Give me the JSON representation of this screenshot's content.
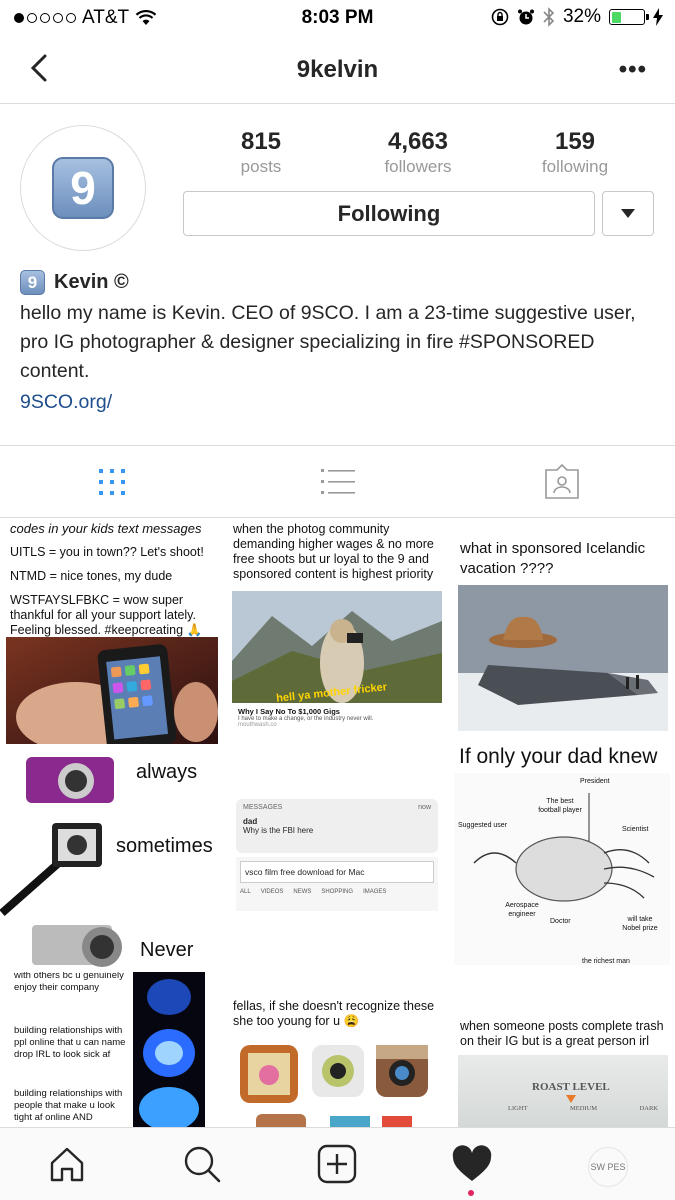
{
  "status_bar": {
    "carrier": "AT&T",
    "time": "8:03 PM",
    "battery_percent": "32%",
    "battery_level": 0.32,
    "signal_bars": 1,
    "icons": [
      "wifi-icon",
      "orientation-lock-icon",
      "alarm-icon",
      "bluetooth-icon",
      "battery-icon",
      "charging-icon"
    ]
  },
  "nav": {
    "title": "9kelvin",
    "more_label": "•••"
  },
  "profile": {
    "avatar_glyph": "9",
    "stats": [
      {
        "value": "815",
        "label": "posts"
      },
      {
        "value": "4,663",
        "label": "followers"
      },
      {
        "value": "159",
        "label": "following"
      }
    ],
    "follow_button_label": "Following",
    "name_badge": "9",
    "name": "Kevin ©",
    "bio": "hello my name is Kevin. CEO of 9SCO. I am a 23-time suggestive user, pro IG photographer & designer specializing in fire #SPONSORED content.",
    "website": "9SCO.org/"
  },
  "view_tabs": [
    {
      "name": "grid",
      "active": true
    },
    {
      "name": "list",
      "active": false
    },
    {
      "name": "tagged",
      "active": false
    }
  ],
  "posts": {
    "p1": {
      "title": "codes in your kids text messages",
      "lines": [
        "UITLS = you in town?? Let's shoot!",
        "NTMD = nice tones, my dude",
        "WSTFAYSLFBKC = wow super thankful for all your support lately. Feeling blessed. #keepcreating 🙏"
      ]
    },
    "p2": {
      "caption": "when the photog community demanding higher wages & no more free shoots but ur loyal to the 9 and sponsored content is highest priority",
      "overlay": "hell ya mother fricker",
      "article_title": "Why I Say No To $1,000 Gigs",
      "article_sub": "I have to make a change, or the industry never will.",
      "article_site": "mouthwash.co"
    },
    "p3": {
      "caption": "what in sponsored Icelandic vacation ????"
    },
    "p4": {
      "labels": [
        "always",
        "sometimes",
        "Never"
      ]
    },
    "p5": {
      "app": "MESSAGES",
      "when": "now",
      "sender": "dad",
      "message": "Why is the FBI here",
      "search": "vsco film free download for Mac",
      "tabs": [
        "ALL",
        "VIDEOS",
        "NEWS",
        "SHOPPING",
        "IMAGES"
      ]
    },
    "p6": {
      "caption": "If only your dad knew",
      "labels": [
        "President",
        "The best football player",
        "Suggested user",
        "Scientist",
        "Aerospace engineer",
        "Doctor",
        "will take Nobel prize",
        "the richest man"
      ]
    },
    "p7": {
      "lines": [
        "with others bc u genuinely enjoy their company",
        "building relationships with ppl online that u can name drop IRL to look sick af",
        "building relationships with people that make u look tight af online AND"
      ]
    },
    "p8": {
      "caption": "fellas, if she doesn't recognize these she too young for u 😩"
    },
    "p9": {
      "caption": "when someone posts complete trash on their IG but is a great person irl",
      "label": "ROAST LEVEL",
      "scale": [
        "LIGHT",
        "MEDIUM",
        "DARK"
      ]
    }
  },
  "tab_bar": {
    "items": [
      "home",
      "search",
      "add",
      "activity",
      "profile"
    ],
    "profile_badge": "SW PES"
  },
  "colors": {
    "link": "#1e4e8c",
    "tab_active": "#3897f0",
    "battery": "#4cd964",
    "notification": "#e0245e"
  }
}
